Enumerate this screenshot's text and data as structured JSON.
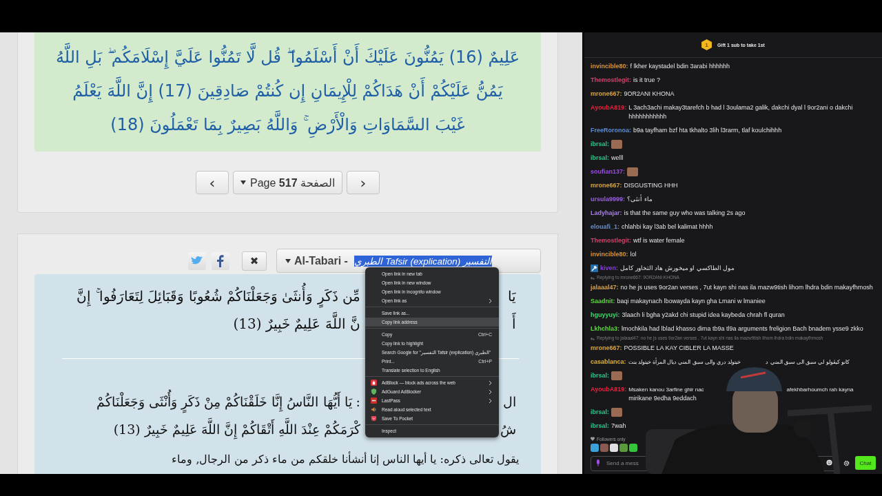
{
  "quran_page": {
    "verse_lines": [
      "عَلِيمٌ (16) يَمُنُّونَ عَلَيْكَ أَنْ أَسْلَمُوا ۖ قُل لَّا تَمُنُّوا عَلَيَّ إِسْلَامَكُم ۖ بَلِ اللَّهُ",
      "يَمُنُّ عَلَيْكُمْ أَنْ هَدَاكُمْ لِلْإِيمَانِ إِن كُنتُمْ صَادِقِينَ (17) إِنَّ اللَّهَ يَعْلَمُ",
      "غَيْبَ السَّمَاوَاتِ وَالْأَرْضِ ۚ وَاللَّهُ بَصِيرٌ بِمَا تَعْمَلُونَ (18)"
    ],
    "pager": {
      "previous": "‹",
      "page_label": "Page **517** الصفحة",
      "next": "›"
    }
  },
  "tafsir": {
    "close": "✖",
    "source": "Al-Tabari - ",
    "selected_text": "الطبري Tafsir (explication) التفسير",
    "verse_lines": [
      [
        "يَا",
        "مِّن ذَكَرٍ وَأُنثَىٰ وَجَعَلْنَاكُمْ شُعُوبًا وَقَبَائِلَ لِتَعَارَفُوا ۚ إِنَّ"
      ],
      [
        "أَ",
        "نَّ اللَّهَ عَلِيمٌ خَبِيرٌ (13)"
      ]
    ],
    "commentary_lines": [
      [
        "ال",
        ": يَا أَيُّهَا النَّاسُ إِنَّا خَلَقْنَاكُمْ مِنْ ذَكَرٍ وَأُنْثَى وَجَعَلْنَاكُمْ"
      ],
      [
        "شُ",
        "كْرَمَكُمْ عِنْدَ اللَّهِ أَتْقَاكُمْ إِنَّ اللَّهَ عَلِيمٌ خَبِيرٌ (13)"
      ],
      [
        "يقول تعالى ذكره: يا أيها الناس إنا أنشأنا خلقكم من ماء ذكر من الرجال, وماء"
      ]
    ]
  },
  "context_menu": {
    "groups": [
      [
        {
          "label": "Open link in new tab",
          "hovered": false,
          "submenu": false
        },
        {
          "label": "Open link in new window",
          "hovered": false,
          "submenu": false
        },
        {
          "label": "Open link in incognito window",
          "hovered": false,
          "submenu": false
        },
        {
          "label": "Open link as",
          "hovered": false,
          "submenu": true
        }
      ],
      [
        {
          "label": "Save link as...",
          "hovered": false,
          "submenu": false
        },
        {
          "label": "Copy link address",
          "hovered": true,
          "submenu": false
        }
      ],
      [
        {
          "label": "Copy",
          "shortcut": "Ctrl+C",
          "hovered": false,
          "submenu": false
        },
        {
          "label": "Copy link to highlight",
          "hovered": false,
          "submenu": false
        },
        {
          "label": "Search Google for \"التفسير Tafsir (explication) الطبري\"",
          "hovered": false,
          "submenu": false
        },
        {
          "label": "Print...",
          "shortcut": "Ctrl+P",
          "hovered": false,
          "submenu": false
        },
        {
          "label": "Translate selection to English",
          "hovered": false,
          "submenu": false
        }
      ],
      [
        {
          "label": "AdBlock — block ads across the web",
          "hovered": false,
          "submenu": true
        },
        {
          "label": "AdGuard AdBlocker",
          "hovered": false,
          "submenu": true
        },
        {
          "label": "LastPass",
          "hovered": false,
          "submenu": true
        },
        {
          "label": "Read aloud selected text",
          "hovered": false,
          "submenu": false
        },
        {
          "label": "Save To Pocket",
          "hovered": false,
          "submenu": false
        }
      ],
      [
        {
          "label": "Inspect",
          "hovered": false,
          "submenu": false
        }
      ]
    ]
  },
  "chat": {
    "header": {
      "badge": "1",
      "text": "Gift 1 sub to take 1st"
    },
    "messages": [
      {
        "user": "invincible80:",
        "color": "#d8943a",
        "moderator": false,
        "kind": "text",
        "text": "f lkher kaystadel bdin 3arabi hhhhhh"
      },
      {
        "user": "Themostlegit:",
        "color": "#d2416b",
        "moderator": false,
        "kind": "text",
        "text": "is it true ?"
      },
      {
        "user": "mrone667:",
        "color": "#d6a542",
        "moderator": false,
        "kind": "text",
        "text": "9OR2ANI KHONA"
      },
      {
        "user": "AyoubA819:",
        "color": "#e2233f",
        "moderator": false,
        "kind": "text",
        "text": "L 3ach3achi makay3tarefch b had l 3oulama2 galik, dakchi dyal l 9or2ani o dakchi hhhhhhhhhhh"
      },
      {
        "user": "FreeRoronoa:",
        "color": "#5a8ed8",
        "moderator": false,
        "kind": "text",
        "text": "b9a tayfham bzf hta tkhalto 3lih l3rarm, tlaf koulchihhh"
      },
      {
        "user": "ibrsal:",
        "color": "#2fc48c",
        "moderator": false,
        "kind": "emote"
      },
      {
        "user": "ibrsal:",
        "color": "#2fc48c",
        "moderator": false,
        "kind": "text",
        "text": "welll"
      },
      {
        "user": "soufian137:",
        "color": "#9b4ce6",
        "moderator": false,
        "kind": "emote"
      },
      {
        "user": "mrone667:",
        "color": "#d6a542",
        "moderator": false,
        "kind": "text",
        "text": "DISGUSTING HHH"
      },
      {
        "user": "ursula9999:",
        "color": "#9d5de8",
        "moderator": false,
        "kind": "text",
        "text": "ماء أنثى؟"
      },
      {
        "user": "Ladyhajar:",
        "color": "#a77fe2",
        "moderator": false,
        "kind": "text",
        "text": "is that the same guy who was talking 2s ago"
      },
      {
        "user": "elouafi_1:",
        "color": "#6b8fc8",
        "moderator": false,
        "kind": "text",
        "text": "chlahbi kay l3ab bel kalimat hhhh"
      },
      {
        "user": "Themostlegit:",
        "color": "#d2416b",
        "moderator": false,
        "kind": "text",
        "text": "wtf is water female"
      },
      {
        "user": "invincible80:",
        "color": "#d8943a",
        "moderator": false,
        "kind": "text",
        "text": "lol"
      },
      {
        "user": "kiven:",
        "color": "#8b3fe2",
        "moderator": true,
        "kind": "text",
        "text": "مول الطاكسي او ميخورش هاد التخاور كامل"
      },
      {
        "user": "jalaaal47:",
        "color": "#d8a24c",
        "moderator": false,
        "kind": "text",
        "reply": "Replying to mrone667: 9OR2ANI KHONA",
        "text": "no he js uses 9or2an verses , 7ut kayn shi nas ila mazw9tish lihom lhdra bdin makayfhmosh"
      },
      {
        "user": "Saadnit:",
        "color": "#5cd83c",
        "moderator": false,
        "kind": "text",
        "text": "baqi makaynach lbowayda kayn gha Lmani w lmaniee"
      },
      {
        "user": "hguyyuyi:",
        "color": "#3cd86c",
        "moderator": false,
        "kind": "text",
        "text": "3laach li bgha y2akd chi stupid idea kaybeda chrah fl quran"
      },
      {
        "user": "Lkhchla3:",
        "color": "#5cd83c",
        "moderator": false,
        "kind": "text",
        "text": "lmochkila had lblad khasso dima tb9a tl9a arguments freligion Bach bnadem ysse9 zkko"
      },
      {
        "user": "mrone667:",
        "color": "#d6a542",
        "moderator": false,
        "kind": "text",
        "reply": "Replying to jalaaal47: no he js uses 9or2an verses , 7ut kayn shi nas ila mazw9tish lihom lhdra bdin makayfhmosh",
        "text": "POSSIBLE LA KAY CIBLER LA MASSE"
      },
      {
        "user": "casablanca:",
        "color": "#d8b23c",
        "moderator": false,
        "kind": "covered",
        "fragments": [
          "كانو كيڤولو لي سبق الى سبق المني د",
          "خيتولد دري والى سبق المني ديال المرأة خيتولد بنت"
        ]
      },
      {
        "user": "ibrsal:",
        "color": "#2fc48c",
        "moderator": false,
        "kind": "emote"
      },
      {
        "user": "AyoubA819:",
        "color": "#e2233f",
        "moderator": false,
        "kind": "covered",
        "fragments": [
          "Msaken kanou 3arfine ghir nac",
          "afekhbarhoumch rah kayna"
        ],
        "continuation": "mirikane 9edha 9eddach"
      },
      {
        "user": "ibrsal:",
        "color": "#2fc48c",
        "moderator": false,
        "kind": "emote"
      },
      {
        "user": "ibrsal:",
        "color": "#2fc48c",
        "moderator": false,
        "kind": "text",
        "text": "7wah"
      }
    ],
    "followers_only": "Followers only",
    "input": {
      "placeholder": "Send a mess"
    },
    "send": "Chat"
  }
}
